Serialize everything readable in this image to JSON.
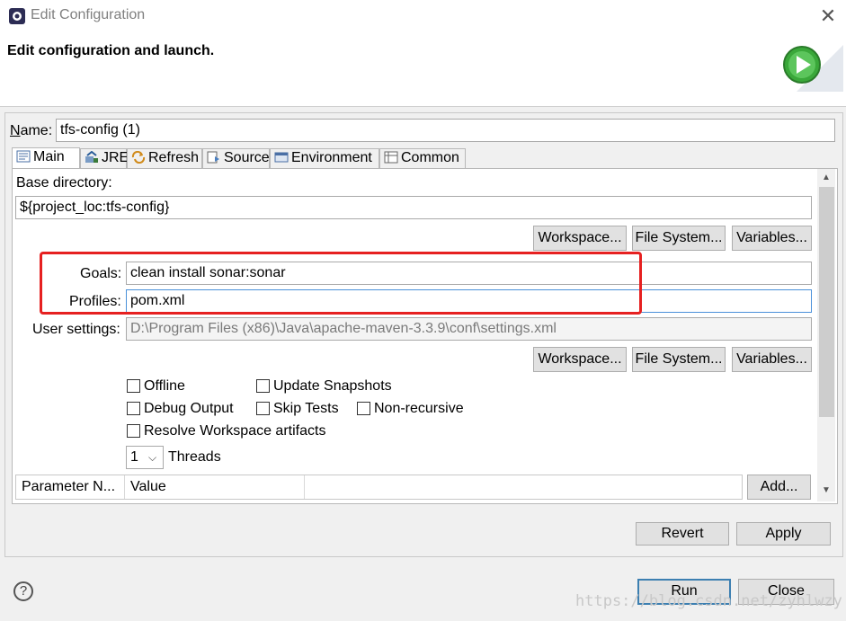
{
  "window": {
    "title": "Edit Configuration",
    "close_glyph": "✕",
    "header_title": "Edit configuration and launch."
  },
  "name_field": {
    "label": "Name:",
    "value": "tfs-config (1)"
  },
  "tabs": [
    {
      "label": "Main",
      "icon": "main-tab-icon",
      "active": true
    },
    {
      "label": "JRE",
      "icon": "jre-icon"
    },
    {
      "label": "Refresh",
      "icon": "refresh-icon"
    },
    {
      "label": "Source",
      "icon": "source-icon"
    },
    {
      "label": "Environment",
      "icon": "environment-icon"
    },
    {
      "label": "Common",
      "icon": "common-icon"
    }
  ],
  "main": {
    "base_directory_label": "Base directory:",
    "base_directory_value": "${project_loc:tfs-config}",
    "buttons_row1": {
      "workspace": "Workspace...",
      "file_system": "File System...",
      "variables": "Variables..."
    },
    "goals_label": "Goals:",
    "goals_value": "clean install sonar:sonar",
    "profiles_label": "Profiles:",
    "profiles_value": "pom.xml",
    "user_settings_label": "User settings:",
    "user_settings_value": "D:\\Program Files (x86)\\Java\\apache-maven-3.3.9\\conf\\settings.xml",
    "buttons_row2": {
      "workspace": "Workspace...",
      "file_system": "File System...",
      "variables": "Variables..."
    },
    "checkboxes": {
      "offline": "Offline",
      "update_snapshots": "Update Snapshots",
      "debug_output": "Debug Output",
      "skip_tests": "Skip Tests",
      "non_recursive": "Non-recursive",
      "resolve_workspace": "Resolve Workspace artifacts"
    },
    "threads_value": "1",
    "threads_label": "Threads",
    "table_headers": [
      "Parameter N...",
      "Value"
    ],
    "add_button": "Add..."
  },
  "footer": {
    "revert": "Revert",
    "apply": "Apply",
    "run": "Run",
    "close": "Close",
    "help_glyph": "?"
  },
  "watermark": "https://blog.csdn.net/zyhlwzy",
  "colors": {
    "highlight_box": "#e62020",
    "focus_border": "#4a90d9",
    "run_green": "#3aa83a"
  }
}
